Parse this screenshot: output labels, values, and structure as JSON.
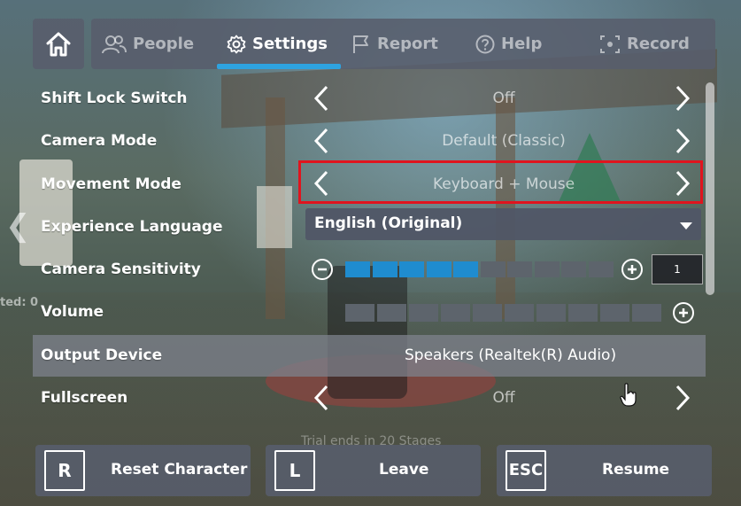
{
  "tabs": [
    {
      "label": "People",
      "icon": "people-icon"
    },
    {
      "label": "Settings",
      "icon": "gear-icon"
    },
    {
      "label": "Report",
      "icon": "flag-icon"
    },
    {
      "label": "Help",
      "icon": "question-icon"
    },
    {
      "label": "Record",
      "icon": "record-icon"
    }
  ],
  "active_tab": "Settings",
  "settings": {
    "shift_lock": {
      "label": "Shift Lock Switch",
      "value": "Off"
    },
    "camera_mode": {
      "label": "Camera Mode",
      "value": "Default (Classic)"
    },
    "movement_mode": {
      "label": "Movement Mode",
      "value": "Keyboard + Mouse"
    },
    "language": {
      "label": "Experience Language",
      "value": "English (Original)"
    },
    "camera_sensitivity": {
      "label": "Camera Sensitivity",
      "level": 5,
      "max": 10,
      "value_text": "1"
    },
    "volume": {
      "label": "Volume",
      "level": 0,
      "max": 10
    },
    "output_device": {
      "label": "Output Device",
      "value": "Speakers (Realtek(R) Audio)"
    },
    "fullscreen": {
      "label": "Fullscreen",
      "value": "Off"
    }
  },
  "bottom": {
    "reset": {
      "key": "R",
      "label": "Reset Character"
    },
    "leave": {
      "key": "L",
      "label": "Leave"
    },
    "resume": {
      "key": "ESC",
      "label": "Resume"
    }
  },
  "background": {
    "side_text": "ted: 0",
    "trial_text": "Trial ends in 20 Stages"
  },
  "colors": {
    "accent": "#2ea3e0",
    "highlight_border": "#e0141e",
    "slider_filled": "#1f8ccf",
    "slider_empty": "#5d646c",
    "panel": "#585d6c"
  }
}
